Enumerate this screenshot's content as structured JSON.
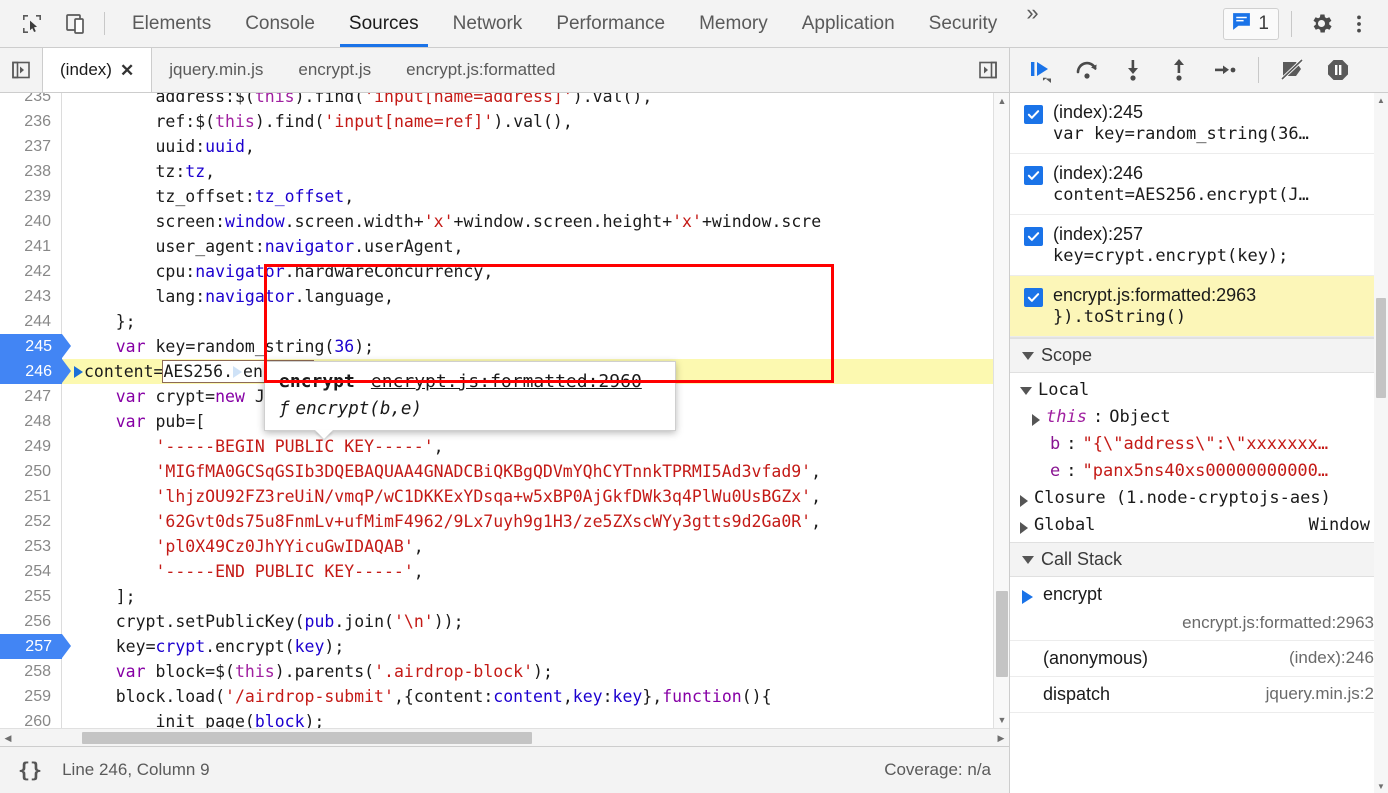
{
  "toolbar": {
    "inspect_icon": "cursor-inspect-icon",
    "device_icon": "device-toolbar-icon",
    "tabs": [
      {
        "label": "Elements",
        "selected": false
      },
      {
        "label": "Console",
        "selected": false
      },
      {
        "label": "Sources",
        "selected": true
      },
      {
        "label": "Network",
        "selected": false
      },
      {
        "label": "Performance",
        "selected": false
      },
      {
        "label": "Memory",
        "selected": false
      },
      {
        "label": "Application",
        "selected": false
      },
      {
        "label": "Security",
        "selected": false
      }
    ],
    "more_tabs": "»",
    "message_count": "1",
    "message_icon": "message-bubble-icon",
    "settings_icon": "gear-icon",
    "kebab_icon": "more-vertical-icon",
    "accent_color": "#1a73e8"
  },
  "file_tabs": {
    "nav_prev_icon": "panel-toggle-left-icon",
    "nav_next_icon": "panel-toggle-right-icon",
    "items": [
      {
        "label": "(index)",
        "active": true,
        "closable": true,
        "close_label": "✕"
      },
      {
        "label": "jquery.min.js",
        "active": false,
        "closable": false
      },
      {
        "label": "encrypt.js",
        "active": false,
        "closable": false
      },
      {
        "label": "encrypt.js:formatted",
        "active": false,
        "closable": false
      }
    ]
  },
  "editor": {
    "lines": [
      {
        "num": "235",
        "text": "        address:$(this).find('input[name=address]').val(),",
        "breakpoint": false,
        "highlight": false,
        "clipped_top": true
      },
      {
        "num": "236",
        "text": "        ref:$(this).find('input[name=ref]').val(),",
        "breakpoint": false,
        "highlight": false
      },
      {
        "num": "237",
        "text": "        uuid:uuid,",
        "breakpoint": false,
        "highlight": false
      },
      {
        "num": "238",
        "text": "        tz:tz,",
        "breakpoint": false,
        "highlight": false
      },
      {
        "num": "239",
        "text": "        tz_offset:tz_offset,",
        "breakpoint": false,
        "highlight": false
      },
      {
        "num": "240",
        "text": "        screen:window.screen.width+'x'+window.screen.height+'x'+window.scre",
        "breakpoint": false,
        "highlight": false
      },
      {
        "num": "241",
        "text": "        user_agent:navigator.userAgent,",
        "breakpoint": false,
        "highlight": false
      },
      {
        "num": "242",
        "text": "        cpu:navigator.hardwareConcurrency,",
        "breakpoint": false,
        "highlight": false
      },
      {
        "num": "243",
        "text": "        lang:navigator.language,",
        "breakpoint": false,
        "highlight": false
      },
      {
        "num": "244",
        "text": "    };",
        "breakpoint": false,
        "highlight": false
      },
      {
        "num": "245",
        "text": "    var key=random_string(36);",
        "breakpoint": true,
        "highlight": false
      },
      {
        "num": "246",
        "text": "    content=AES256.encrypt(JSON.stringify(content),key);",
        "breakpoint": true,
        "highlight": true
      },
      {
        "num": "247",
        "text": "    var crypt=new JSEncrypt();",
        "breakpoint": false,
        "highlight": false
      },
      {
        "num": "248",
        "text": "    var pub=[",
        "breakpoint": false,
        "highlight": false
      },
      {
        "num": "249",
        "text": "        '-----BEGIN PUBLIC KEY-----',",
        "breakpoint": false,
        "highlight": false
      },
      {
        "num": "250",
        "text": "        'MIGfMA0GCSqGSIb3DQEBAQUAA4GNADCBiQKBgQDVmYQhCYTnnkTPRMI5Ad3vfad9',",
        "breakpoint": false,
        "highlight": false
      },
      {
        "num": "251",
        "text": "        'lhjzOU92FZ3reUiN/vmqP/wC1DKKExYDsqa+w5xBP0AjGkfDWk3q4PlWu0UsBGZx',",
        "breakpoint": false,
        "highlight": false
      },
      {
        "num": "252",
        "text": "        '62Gvt0ds75u8FnmLv+ufMimF4962/9Lx7uyh9g1H3/ze5ZXscWYy3gtts9d2Ga0R',",
        "breakpoint": false,
        "highlight": false
      },
      {
        "num": "253",
        "text": "        'pl0X49Cz0JhYYicuGwIDAQAB',",
        "breakpoint": false,
        "highlight": false
      },
      {
        "num": "254",
        "text": "        '-----END PUBLIC KEY-----',",
        "breakpoint": false,
        "highlight": false
      },
      {
        "num": "255",
        "text": "    ];",
        "breakpoint": false,
        "highlight": false
      },
      {
        "num": "256",
        "text": "    crypt.setPublicKey(pub.join('\\n'));",
        "breakpoint": false,
        "highlight": false
      },
      {
        "num": "257",
        "text": "    key=crypt.encrypt(key);",
        "breakpoint": true,
        "highlight": false
      },
      {
        "num": "258",
        "text": "    var block=$(this).parents('.airdrop-block');",
        "breakpoint": false,
        "highlight": false
      },
      {
        "num": "259",
        "text": "    block.load('/airdrop-submit',{content:content,key:key},function(){",
        "breakpoint": false,
        "highlight": false
      },
      {
        "num": "260",
        "text": "        init_page(block);",
        "breakpoint": false,
        "highlight": false
      },
      {
        "num": "261",
        "text": "",
        "breakpoint": false,
        "highlight": false,
        "clipped_bottom": true
      }
    ]
  },
  "popup": {
    "function_name": "encrypt",
    "source_link": "encrypt.js:formatted:2960",
    "f_glyph": "ƒ",
    "signature": "encrypt(b,e)"
  },
  "status": {
    "format_icon": "pretty-print-braces-icon",
    "format_label": "{}",
    "cursor_position": "Line 246, Column 9",
    "coverage": "Coverage: n/a"
  },
  "debugger": {
    "buttons": [
      {
        "name": "resume-script-execution",
        "icon": "resume-icon",
        "active": true
      },
      {
        "name": "step-over-next-function-call",
        "icon": "step-over-icon",
        "active": false
      },
      {
        "name": "step-into-next-function-call",
        "icon": "step-into-icon",
        "active": false
      },
      {
        "name": "step-out-of-current-function",
        "icon": "step-out-icon",
        "active": false
      },
      {
        "name": "step",
        "icon": "step-icon",
        "active": false
      },
      {
        "name": "deactivate-breakpoints",
        "icon": "deactivate-breakpoints-icon",
        "active": false
      },
      {
        "name": "pause-on-exceptions",
        "icon": "pause-on-exceptions-icon",
        "active": false
      }
    ],
    "breakpoints": [
      {
        "location": "(index):245",
        "snippet": "var key=random_string(36…",
        "checked": true,
        "selected": false
      },
      {
        "location": "(index):246",
        "snippet": "content=AES256.encrypt(J…",
        "checked": true,
        "selected": false
      },
      {
        "location": "(index):257",
        "snippet": "key=crypt.encrypt(key);",
        "checked": true,
        "selected": false
      },
      {
        "location": "encrypt.js:formatted:2963",
        "snippet": "}).toString()",
        "checked": true,
        "selected": true
      }
    ],
    "scope": {
      "title": "Scope",
      "groups": [
        {
          "name": "Local",
          "expanded": true,
          "rows": [
            {
              "key": "this",
              "sep": ":",
              "value": "Object",
              "expandable": true,
              "italic_key": true,
              "value_kind": "object"
            },
            {
              "key": "b",
              "sep": ":",
              "value": "\"{\\\"address\\\":\\\"xxxxxxx…",
              "expandable": false,
              "italic_key": false,
              "value_kind": "string"
            },
            {
              "key": "e",
              "sep": ":",
              "value": "\"panx5ns40xs00000000000…",
              "expandable": false,
              "italic_key": false,
              "value_kind": "string"
            }
          ]
        },
        {
          "name": "Closure (1.node-cryptojs-aes)",
          "expanded": false,
          "rows": []
        },
        {
          "name": "Global",
          "expanded": false,
          "right_value": "Window",
          "rows": []
        }
      ]
    },
    "call_stack": {
      "title": "Call Stack",
      "frames": [
        {
          "fn": "encrypt",
          "source": "encrypt.js:formatted:2963",
          "current": true,
          "two_line": true
        },
        {
          "fn": "(anonymous)",
          "source": "(index):246",
          "current": false,
          "two_line": false
        },
        {
          "fn": "dispatch",
          "source": "jquery.min.js:2",
          "current": false,
          "two_line": false
        }
      ]
    }
  },
  "colors": {
    "accent": "#1a73e8",
    "breakpoint_blue": "#4285f4",
    "highlight_yellow": "#fcf9b0",
    "selection_yellow": "#fcf6b8",
    "annotation_red": "#ff0000",
    "string_red": "#c41a16",
    "keyword_purple": "#8600a5",
    "identifier_blue": "#1c00cf"
  }
}
